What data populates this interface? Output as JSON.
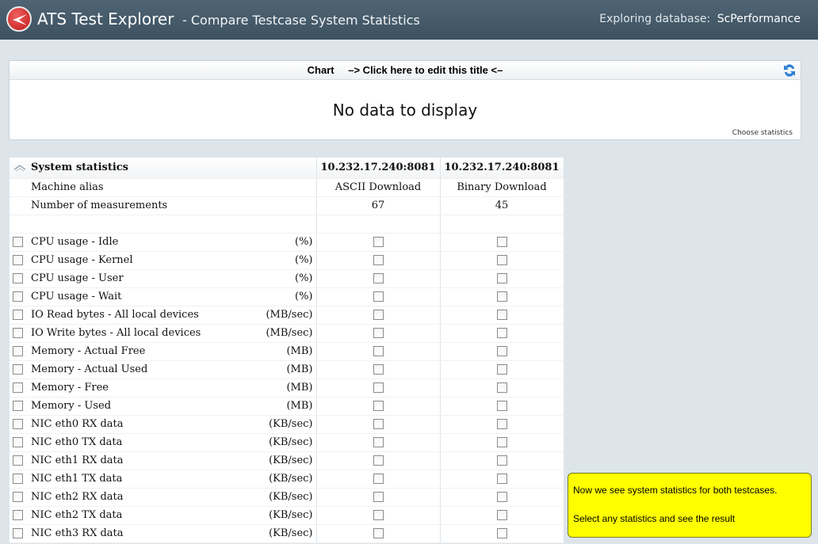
{
  "header": {
    "app_title": "ATS Test Explorer",
    "subtitle": "- Compare Testcase System Statistics",
    "db_label": "Exploring database:",
    "db_name": "ScPerformance",
    "logo_icon": "ats-logo-icon"
  },
  "chart_panel": {
    "label": "Chart",
    "title_prompt": "–> Click here to edit this title <–",
    "empty_message": "No data to display",
    "choose_stats": "Choose statistics",
    "refresh_icon": "refresh-icon"
  },
  "stats_table": {
    "header": {
      "title": "System statistics",
      "columns": [
        "10.232.17.240:8081",
        "10.232.17.240:8081"
      ]
    },
    "machine_alias": {
      "label": "Machine alias",
      "values": [
        "ASCII Download",
        "Binary Download"
      ]
    },
    "measurements": {
      "label": "Number of measurements",
      "values": [
        "67",
        "45"
      ]
    },
    "rows": [
      {
        "label": "CPU usage - Idle",
        "unit": "(%)"
      },
      {
        "label": "CPU usage - Kernel",
        "unit": "(%)"
      },
      {
        "label": "CPU usage - User",
        "unit": "(%)"
      },
      {
        "label": "CPU usage - Wait",
        "unit": "(%)"
      },
      {
        "label": "IO Read bytes - All local devices",
        "unit": "(MB/sec)"
      },
      {
        "label": "IO Write bytes - All local devices",
        "unit": "(MB/sec)"
      },
      {
        "label": "Memory - Actual Free",
        "unit": "(MB)"
      },
      {
        "label": "Memory - Actual Used",
        "unit": "(MB)"
      },
      {
        "label": "Memory - Free",
        "unit": "(MB)"
      },
      {
        "label": "Memory - Used",
        "unit": "(MB)"
      },
      {
        "label": "NIC eth0 RX data",
        "unit": "(KB/sec)"
      },
      {
        "label": "NIC eth0 TX data",
        "unit": "(KB/sec)"
      },
      {
        "label": "NIC eth1 RX data",
        "unit": "(KB/sec)"
      },
      {
        "label": "NIC eth1 TX data",
        "unit": "(KB/sec)"
      },
      {
        "label": "NIC eth2 RX data",
        "unit": "(KB/sec)"
      },
      {
        "label": "NIC eth2 TX data",
        "unit": "(KB/sec)"
      },
      {
        "label": "NIC eth3 RX data",
        "unit": "(KB/sec)"
      }
    ]
  },
  "tooltip": {
    "line1": "Now we see system statistics for both testcases.",
    "line2": "Select any statistics and see the result",
    "color": "#ffff00"
  }
}
